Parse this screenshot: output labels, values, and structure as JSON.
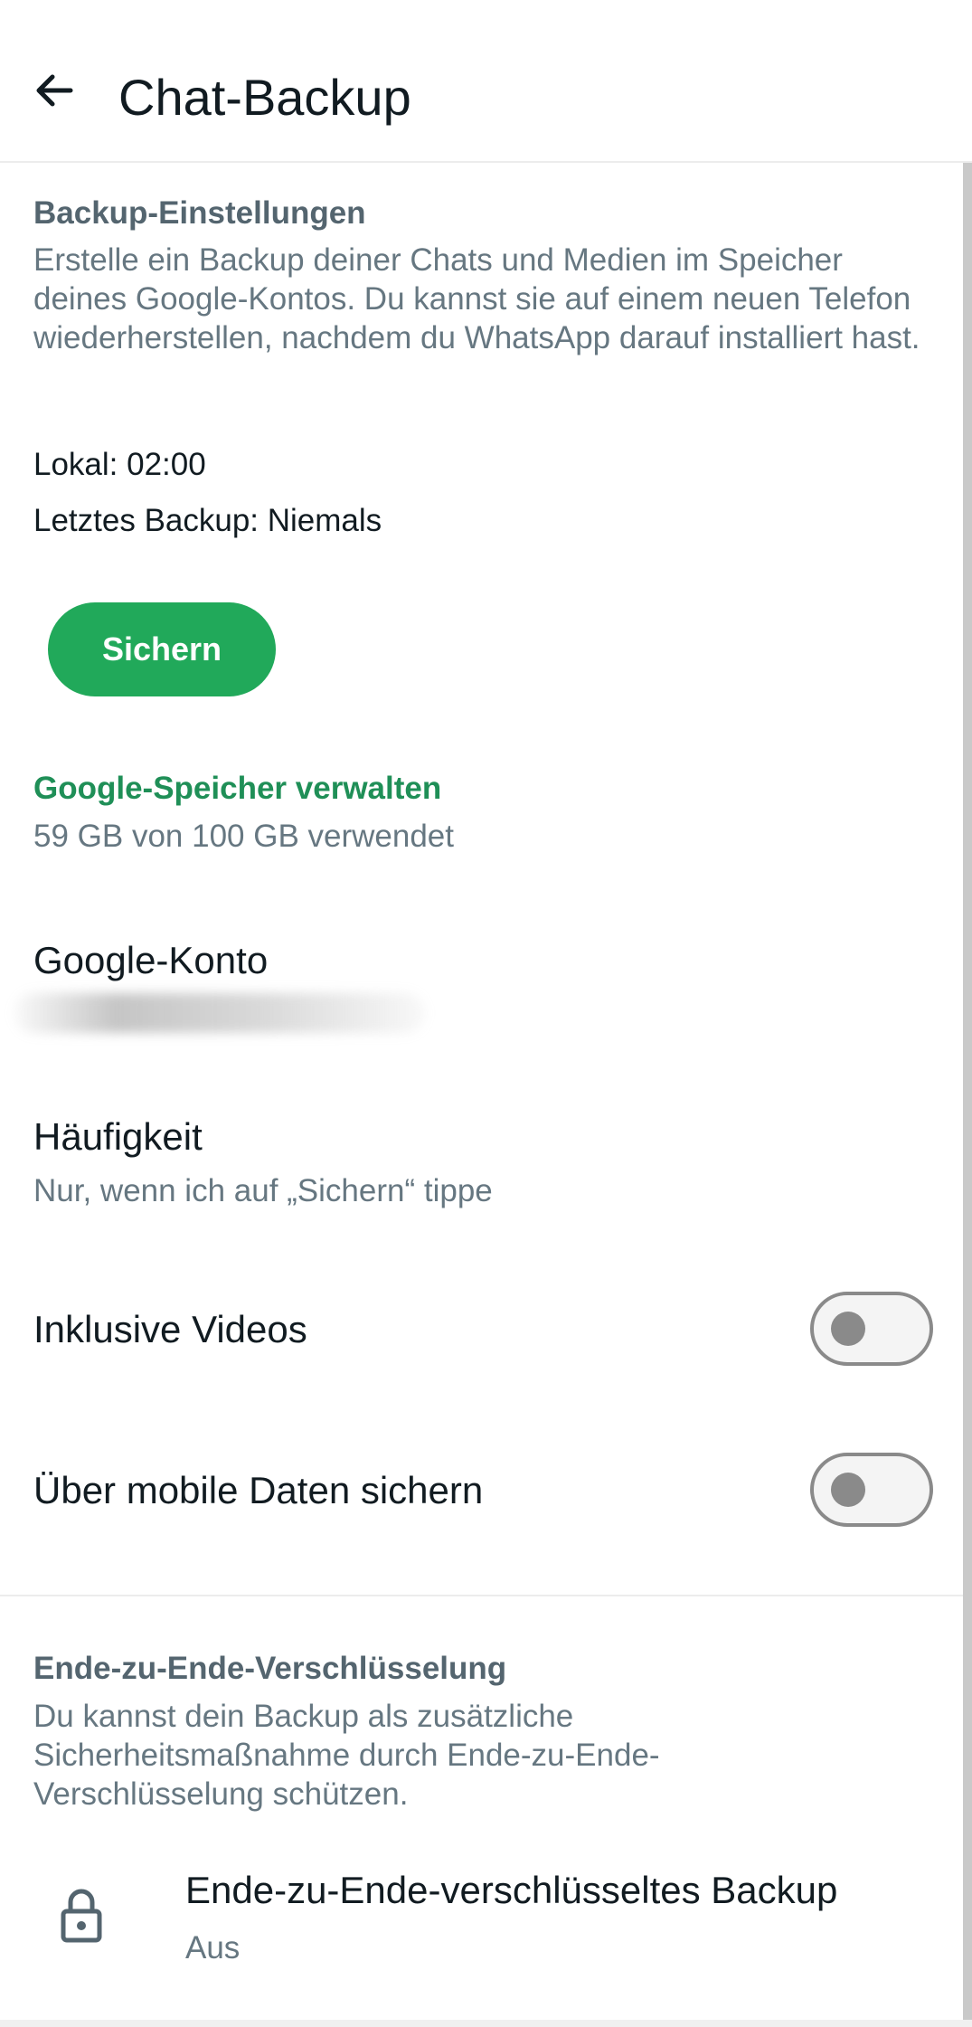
{
  "appbar": {
    "title": "Chat-Backup",
    "back_icon": "arrow-left-icon"
  },
  "backup_settings": {
    "header": "Backup-Einstellungen",
    "description": "Erstelle ein Backup deiner Chats und Medien im Speicher deines Google-Kontos. Du kannst sie auf einem neuen Telefon wiederherstellen, nachdem du WhatsApp darauf installiert hast.",
    "local": "Lokal: 02:00",
    "last_backup": "Letztes Backup: Niemals",
    "backup_button": "Sichern",
    "accent_color": "#21a95a"
  },
  "storage": {
    "manage_label": "Google-Speicher verwalten",
    "usage": "59 GB von 100 GB verwendet",
    "usage_fraction": 0.59
  },
  "google_account": {
    "title": "Google-Konto"
  },
  "frequency": {
    "title": "Häufigkeit",
    "value": "Nur, wenn ich auf „Sichern“ tippe"
  },
  "toggles": {
    "include_videos": {
      "label": "Inklusive Videos",
      "on": false
    },
    "mobile_data": {
      "label": "Über mobile Daten sichern",
      "on": false
    }
  },
  "encryption": {
    "header": "Ende-zu-Ende-Verschlüsselung",
    "description": "Du kannst dein Backup als zusätzliche Sicherheitsmaßnahme durch Ende-zu-Ende-Verschlüsselung schützen.",
    "item_title": "Ende-zu-Ende-verschlüsseltes Backup",
    "item_status": "Aus",
    "icon": "lock-icon"
  }
}
